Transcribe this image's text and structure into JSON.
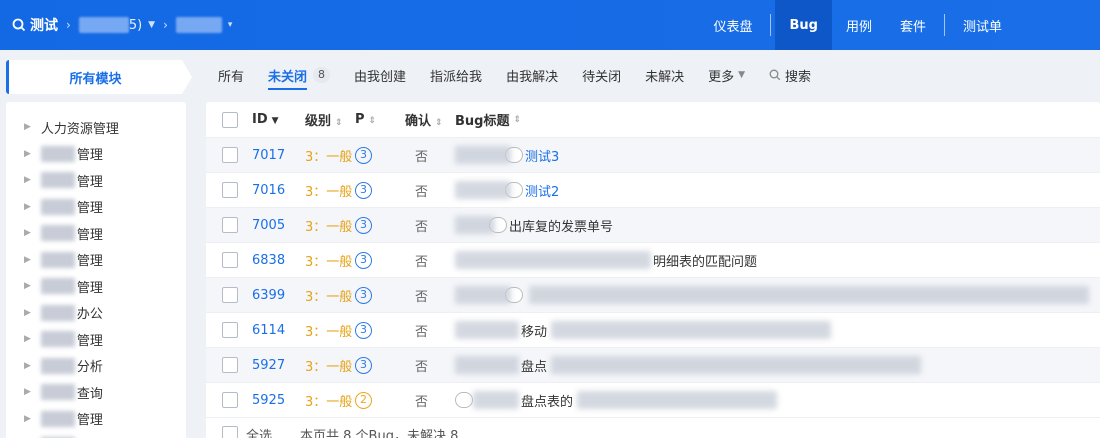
{
  "header": {
    "brand_label": "测试",
    "crumb_suffix": "5)",
    "nav": [
      {
        "label": "仪表盘",
        "active": false
      },
      {
        "label": "Bug",
        "active": true
      },
      {
        "label": "用例",
        "active": false
      },
      {
        "label": "套件",
        "active": false
      },
      {
        "label": "测试单",
        "active": false
      }
    ]
  },
  "sidebar": {
    "module_tab_label": "所有模块",
    "items": [
      {
        "label": "人力资源管理"
      },
      {
        "label": "管理"
      },
      {
        "label": "管理"
      },
      {
        "label": "管理"
      },
      {
        "label": "管理"
      },
      {
        "label": "管理"
      },
      {
        "label": "管理"
      },
      {
        "label": "办公"
      },
      {
        "label": "管理"
      },
      {
        "label": "分析"
      },
      {
        "label": "查询"
      },
      {
        "label": "管理"
      },
      {
        "label": "管理"
      }
    ]
  },
  "filters": {
    "tabs": [
      {
        "label": "所有"
      },
      {
        "label": "未关闭",
        "badge": "8",
        "active": true
      },
      {
        "label": "由我创建"
      },
      {
        "label": "指派给我"
      },
      {
        "label": "由我解决"
      },
      {
        "label": "待关闭"
      },
      {
        "label": "未解决"
      },
      {
        "label": "更多"
      }
    ],
    "search_label": "搜索"
  },
  "table": {
    "headers": {
      "id": "ID",
      "level": "级别",
      "priority": "P",
      "confirm": "确认",
      "title": "Bug标题"
    },
    "rows": [
      {
        "id": "7017",
        "level": "3：一般",
        "priority": "3",
        "confirm": "否",
        "title": "测试3"
      },
      {
        "id": "7016",
        "level": "3：一般",
        "priority": "3",
        "confirm": "否",
        "title": "测试2"
      },
      {
        "id": "7005",
        "level": "3：一般",
        "priority": "3",
        "confirm": "否",
        "title": "出库复的发票单号"
      },
      {
        "id": "6838",
        "level": "3：一般",
        "priority": "3",
        "confirm": "否",
        "title": "明细表的匹配问题"
      },
      {
        "id": "6399",
        "level": "3：一般",
        "priority": "3",
        "confirm": "否",
        "title": ""
      },
      {
        "id": "6114",
        "level": "3：一般",
        "priority": "3",
        "confirm": "否",
        "title": "移动"
      },
      {
        "id": "5927",
        "level": "3：一般",
        "priority": "3",
        "confirm": "否",
        "title": "盘点"
      },
      {
        "id": "5925",
        "level": "3：一般",
        "priority": "2",
        "confirm": "否",
        "title": "盘点表的"
      }
    ],
    "footer": {
      "select_all": "全选",
      "summary": "本页共 8 个Bug，未解决 8"
    }
  },
  "colors": {
    "accent": "#1a6fe8",
    "header_bg": "#1369e4",
    "level_color": "#e6a317",
    "pri3_color": "#2e7be6",
    "pri2_color": "#f0a522"
  }
}
